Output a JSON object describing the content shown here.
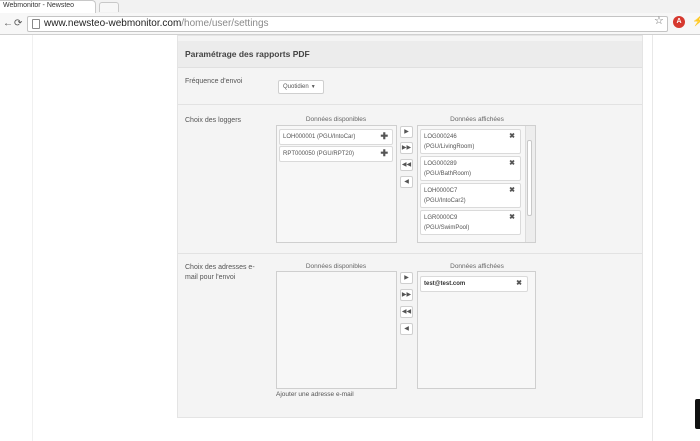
{
  "browser": {
    "tab_title": "Webmonitor - Newsteo",
    "url_host": "www.newsteo-webmonitor.com",
    "url_path": "/home/user/settings",
    "icons": [
      "back-arrow-icon",
      "forward-arrow-icon",
      "reload-icon",
      "home-icon",
      "page-icon",
      "star-icon",
      "extension-icon"
    ]
  },
  "panel": {
    "title": "Paramétrage des rapports PDF",
    "frequency": {
      "label": "Fréquence d'envoi",
      "selected": "Quotidien"
    },
    "loggers": {
      "label": "Choix des loggers",
      "available_header": "Données disponibles",
      "displayed_header": "Données affichées",
      "available": [
        "LOH000001 (PGU/IntoCar)",
        "RPT000050 (PGU/RPT20)"
      ],
      "displayed": [
        {
          "id": "LOG000246",
          "place": "(PGU/LivingRoom)"
        },
        {
          "id": "LOG000289",
          "place": "(PGU/BathRoom)"
        },
        {
          "id": "LOH0000C7",
          "place": "(PGU/IntoCar2)"
        },
        {
          "id": "LGR0000C9",
          "place": "(PGU/SwimPool)"
        }
      ]
    },
    "emails": {
      "label": "Choix des adresses e-mail pour l'envoi",
      "available_header": "Données disponibles",
      "displayed_header": "Données affichées",
      "displayed": [
        "test@test.com"
      ],
      "add_link": "Ajouter une adresse e-mail"
    },
    "arrows": [
      "▶",
      "▶▶",
      "◀◀",
      "◀"
    ]
  }
}
